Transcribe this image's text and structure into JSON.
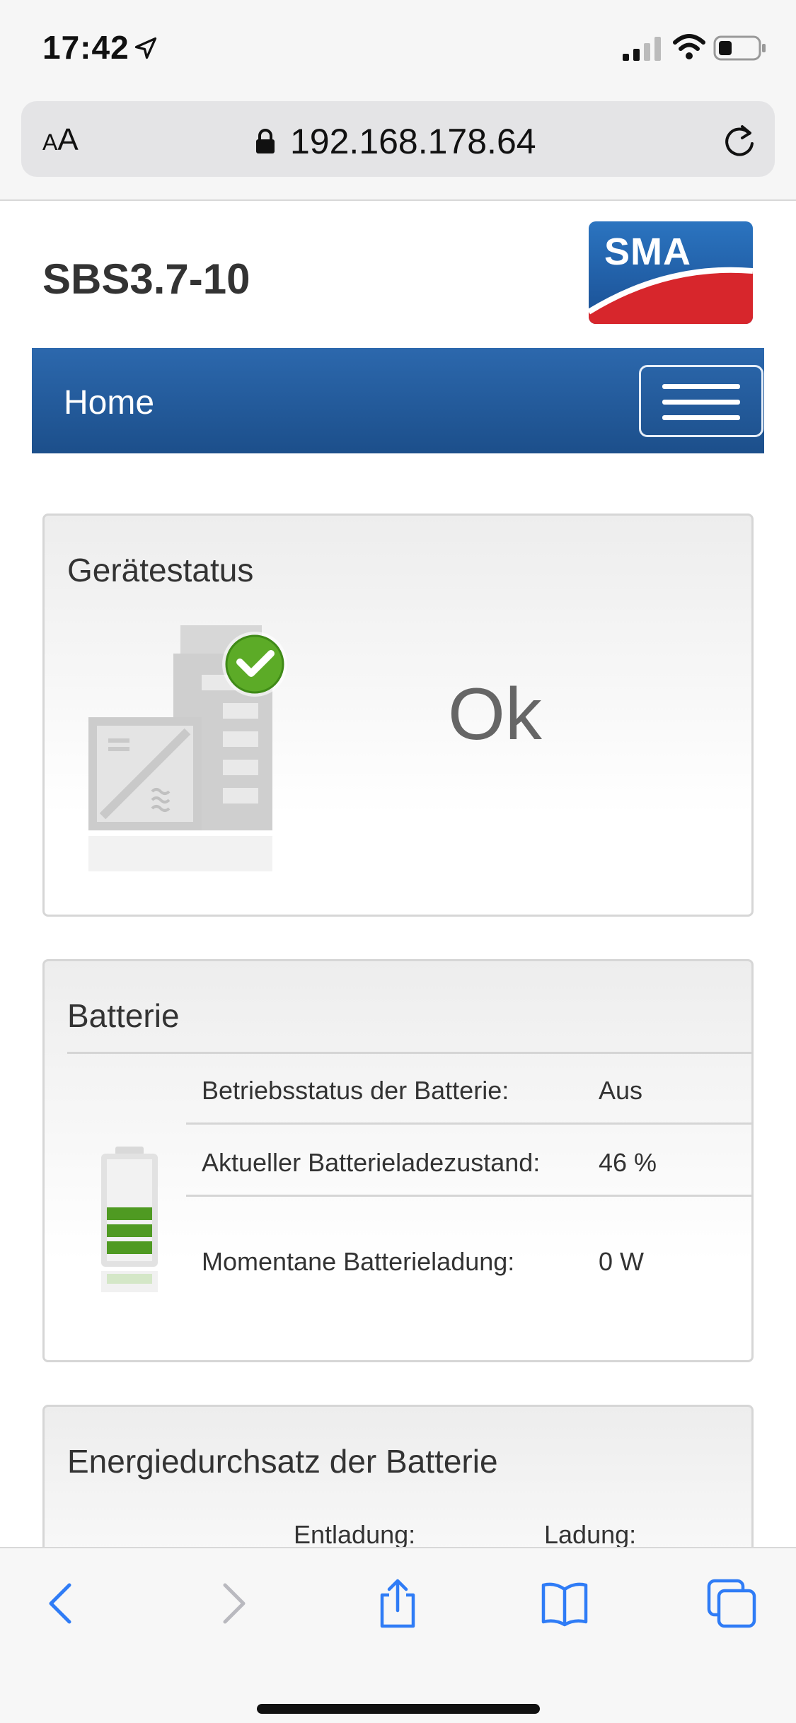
{
  "status_bar": {
    "time": "17:42"
  },
  "browser": {
    "text_size_label_small": "A",
    "text_size_label_large": "A",
    "url": "192.168.178.64"
  },
  "header": {
    "device_name": "SBS3.7-10",
    "logo_text": "SMA"
  },
  "nav": {
    "title": "Home"
  },
  "device_status": {
    "title": "Gerätestatus",
    "status": "Ok"
  },
  "battery": {
    "title": "Batterie",
    "rows": [
      {
        "label": "Betriebsstatus der Batterie:",
        "value": "Aus"
      },
      {
        "label": "Aktueller Batterieladezustand:",
        "value": "46 %"
      },
      {
        "label": "Momentane Batterieladung:",
        "value": "0 W"
      }
    ],
    "charge_level_percent": 46
  },
  "energy_throughput": {
    "title": "Energiedurchsatz der Batterie",
    "columns": [
      "Entladung:",
      "Ladung:"
    ]
  },
  "colors": {
    "nav_blue": "#1c4f8b",
    "logo_blue": "#1d5fa8",
    "logo_red": "#d7262c",
    "status_green": "#5cab27",
    "battery_green": "#4f9a22"
  },
  "icons": {
    "location": "location-arrow-icon",
    "signal": "cellular-signal-icon",
    "wifi": "wifi-icon",
    "battery": "battery-status-icon",
    "lock": "lock-icon",
    "reload": "reload-icon",
    "menu": "hamburger-menu-icon",
    "back": "chevron-left-icon",
    "forward": "chevron-right-icon",
    "share": "share-icon",
    "bookmarks": "book-icon",
    "tabs": "tabs-icon"
  }
}
